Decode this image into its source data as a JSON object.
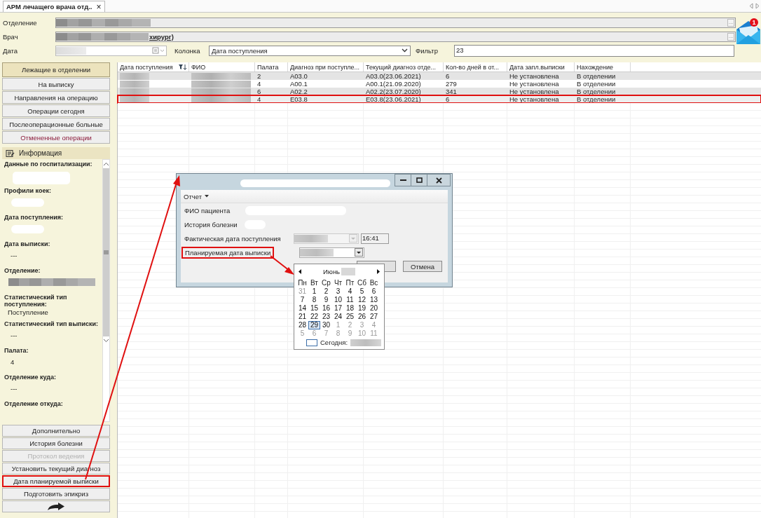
{
  "tab": {
    "title": "АРМ лечащего врача отд..",
    "close": "×",
    "selected": true
  },
  "header": {
    "lookups": [
      {
        "label": "Отделение",
        "button": "..."
      },
      {
        "label": "Врач",
        "value_tail": "хирург)",
        "button": "..."
      }
    ],
    "date": {
      "label": "Дата"
    },
    "column": {
      "label": "Колонка",
      "value": "Дата поступления"
    },
    "filter": {
      "label": "Фильтр",
      "value": "23"
    },
    "mail_badge": "1"
  },
  "sidebar": {
    "tabs": [
      {
        "label": "Лежащие в отделении",
        "selected": true,
        "alert": false
      },
      {
        "label": "На выписку",
        "selected": false,
        "alert": false
      },
      {
        "label": "Направления на операцию",
        "selected": false,
        "alert": false
      },
      {
        "label": "Операции сегодня",
        "selected": false,
        "alert": false
      },
      {
        "label": "Послеоперационные больные",
        "selected": false,
        "alert": false
      },
      {
        "label": "Отмененные операции",
        "selected": false,
        "alert": true
      }
    ],
    "info": {
      "title": "Информация",
      "items": [
        {
          "label": "Данные по госпитализации:",
          "kind": "hidden_wide"
        },
        {
          "label": "Профили коек:",
          "kind": "hidden"
        },
        {
          "label": "Дата поступления:",
          "kind": "hidden"
        },
        {
          "label": "Дата выписки:",
          "kind": "text",
          "value": "---"
        },
        {
          "label": "Отделение:",
          "kind": "hidden_dark"
        },
        {
          "label": "Статистический тип поступления:",
          "kind": "text",
          "value": "Поступление"
        },
        {
          "label": "Статистический тип выписки:",
          "kind": "text",
          "value": "---"
        },
        {
          "label": "Палата:",
          "kind": "text",
          "value": "4"
        },
        {
          "label": "Отделение куда:",
          "kind": "text",
          "value": "---"
        },
        {
          "label": "Отделение откуда:",
          "kind": "none"
        }
      ]
    },
    "actions": [
      {
        "kind": "text",
        "label": "Дополнительно",
        "disabled": false,
        "highlighted": false
      },
      {
        "kind": "text",
        "label": "История болезни",
        "disabled": false,
        "highlighted": false
      },
      {
        "kind": "text",
        "label": "Протокол ведения",
        "disabled": true,
        "highlighted": false
      },
      {
        "kind": "text",
        "label": "Установить текущий диагноз",
        "disabled": false,
        "highlighted": false
      },
      {
        "kind": "text",
        "label": "Дата планируемой выписки",
        "disabled": false,
        "highlighted": true
      },
      {
        "kind": "text",
        "label": "Подготовить эпикриз",
        "disabled": false,
        "highlighted": false
      },
      {
        "kind": "arrow",
        "disabled": false,
        "highlighted": false
      }
    ]
  },
  "table": {
    "columns": [
      {
        "label": "Дата поступления",
        "sorted": true
      },
      {
        "label": "ФИО",
        "sorted": false
      },
      {
        "label": "Палата",
        "sorted": false
      },
      {
        "label": "Диагноз при поступле...",
        "sorted": false
      },
      {
        "label": "Текущий диагноз отде...",
        "sorted": false
      },
      {
        "label": "Кол-во дней в от...",
        "sorted": false
      },
      {
        "label": "Дата запл.выписки",
        "sorted": false
      },
      {
        "label": "Нахождение",
        "sorted": false
      }
    ],
    "rows": [
      {
        "ward": "2",
        "diag_admit": "A03.0",
        "diag_current": "A03.0(23.06.2021)",
        "days": "6",
        "discharge": "Не установлена",
        "location": "В отделении",
        "highlighted": false
      },
      {
        "ward": "4",
        "diag_admit": "A00.1",
        "diag_current": "A00.1(21.09.2020)",
        "days": "279",
        "discharge": "Не установлена",
        "location": "В отделении",
        "highlighted": false
      },
      {
        "ward": "6",
        "diag_admit": "A02.2",
        "diag_current": "A02.2(23.07.2020)",
        "days": "341",
        "discharge": "Не установлена",
        "location": "В отделении",
        "highlighted": false
      },
      {
        "ward": "4",
        "diag_admit": "E03.8",
        "diag_current": "E03.8(23.06.2021)",
        "days": "6",
        "discharge": "Не установлена",
        "location": "В отделении",
        "highlighted": true
      }
    ]
  },
  "dialog": {
    "menu": "Отчет",
    "fields": [
      {
        "label": "ФИО пациента",
        "kind": "hidden_wide",
        "highlighted": false
      },
      {
        "label": "История болезни",
        "kind": "hidden",
        "highlighted": false
      },
      {
        "label": "Фактическая дата поступления",
        "kind": "datetime",
        "time": "16:41",
        "disabled": true,
        "highlighted": false
      },
      {
        "label": "Планируемая дата выписки",
        "kind": "date",
        "disabled": false,
        "highlighted": true
      }
    ],
    "cancel": "Отмена"
  },
  "calendar": {
    "month": "Июнь",
    "weekdays": [
      "Пн",
      "Вт",
      "Ср",
      "Чт",
      "Пт",
      "Сб",
      "Вс"
    ],
    "weeks": [
      [
        {
          "d": "31",
          "other": true,
          "selected": false
        },
        {
          "d": "1",
          "other": false,
          "selected": false
        },
        {
          "d": "2",
          "other": false,
          "selected": false
        },
        {
          "d": "3",
          "other": false,
          "selected": false
        },
        {
          "d": "4",
          "other": false,
          "selected": false
        },
        {
          "d": "5",
          "other": false,
          "selected": false
        },
        {
          "d": "6",
          "other": false,
          "selected": false
        }
      ],
      [
        {
          "d": "7",
          "other": false,
          "selected": false
        },
        {
          "d": "8",
          "other": false,
          "selected": false
        },
        {
          "d": "9",
          "other": false,
          "selected": false
        },
        {
          "d": "10",
          "other": false,
          "selected": false
        },
        {
          "d": "11",
          "other": false,
          "selected": false
        },
        {
          "d": "12",
          "other": false,
          "selected": false
        },
        {
          "d": "13",
          "other": false,
          "selected": false
        }
      ],
      [
        {
          "d": "14",
          "other": false,
          "selected": false
        },
        {
          "d": "15",
          "other": false,
          "selected": false
        },
        {
          "d": "16",
          "other": false,
          "selected": false
        },
        {
          "d": "17",
          "other": false,
          "selected": false
        },
        {
          "d": "18",
          "other": false,
          "selected": false
        },
        {
          "d": "19",
          "other": false,
          "selected": false
        },
        {
          "d": "20",
          "other": false,
          "selected": false
        }
      ],
      [
        {
          "d": "21",
          "other": false,
          "selected": false
        },
        {
          "d": "22",
          "other": false,
          "selected": false
        },
        {
          "d": "23",
          "other": false,
          "selected": false
        },
        {
          "d": "24",
          "other": false,
          "selected": false
        },
        {
          "d": "25",
          "other": false,
          "selected": false
        },
        {
          "d": "26",
          "other": false,
          "selected": false
        },
        {
          "d": "27",
          "other": false,
          "selected": false
        }
      ],
      [
        {
          "d": "28",
          "other": false,
          "selected": false
        },
        {
          "d": "29",
          "other": false,
          "selected": true
        },
        {
          "d": "30",
          "other": false,
          "selected": false
        },
        {
          "d": "1",
          "other": true,
          "selected": false
        },
        {
          "d": "2",
          "other": true,
          "selected": false
        },
        {
          "d": "3",
          "other": true,
          "selected": false
        },
        {
          "d": "4",
          "other": true,
          "selected": false
        }
      ],
      [
        {
          "d": "5",
          "other": true,
          "selected": false
        },
        {
          "d": "6",
          "other": true,
          "selected": false
        },
        {
          "d": "7",
          "other": true,
          "selected": false
        },
        {
          "d": "8",
          "other": true,
          "selected": false
        },
        {
          "d": "9",
          "other": true,
          "selected": false
        },
        {
          "d": "10",
          "other": true,
          "selected": false
        },
        {
          "d": "11",
          "other": true,
          "selected": false
        }
      ]
    ],
    "today_label": "Сегодня:"
  }
}
